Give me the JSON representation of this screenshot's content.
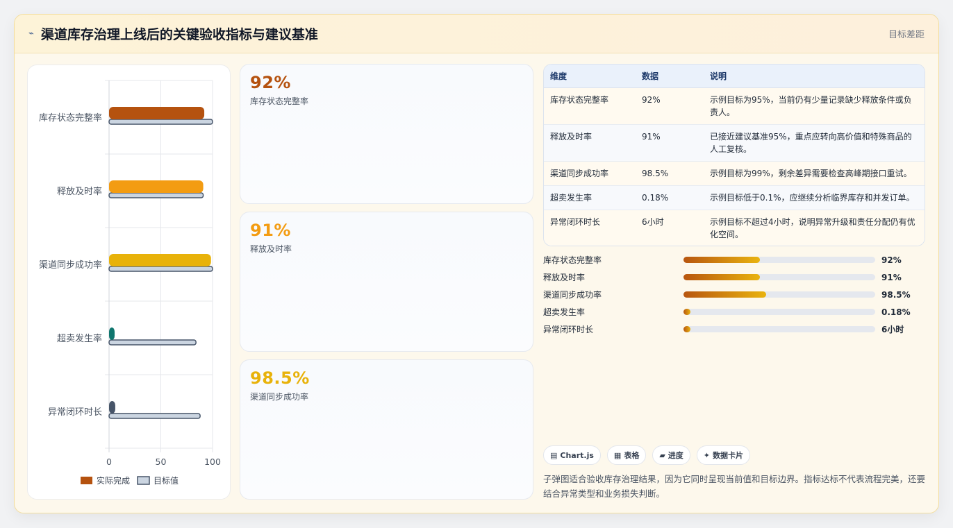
{
  "header": {
    "icon": "line-chart-icon",
    "title": "渠道库存治理上线后的关键验收指标与建议基准",
    "right_label": "目标差距"
  },
  "chart_data": {
    "type": "bar",
    "orientation": "horizontal",
    "categories": [
      "库存状态完整率",
      "释放及时率",
      "渠道同步成功率",
      "超卖发生率",
      "异常闭环时长"
    ],
    "series": [
      {
        "name": "实际完成",
        "values": [
          92,
          91,
          98.5,
          5,
          6
        ],
        "colors": [
          "#b5520f",
          "#f39c12",
          "#e8b20a",
          "#0f766e",
          "#475569"
        ]
      },
      {
        "name": "目标值",
        "values": [
          100,
          91,
          100,
          84,
          88
        ],
        "color": "#cbd5e1"
      }
    ],
    "xlim": [
      0,
      100
    ],
    "xticks": [
      "0",
      "50",
      "100"
    ],
    "legend_position": "bottom",
    "grid": true
  },
  "stats": [
    {
      "value": "92%",
      "label": "库存状态完整率",
      "color": "#b5520f"
    },
    {
      "value": "91%",
      "label": "释放及时率",
      "color": "#f39c12"
    },
    {
      "value": "98.5%",
      "label": "渠道同步成功率",
      "color": "#e8b20a"
    }
  ],
  "table": {
    "headers": [
      "维度",
      "数据",
      "说明"
    ],
    "rows": [
      [
        "库存状态完整率",
        "92%",
        "示例目标为95%，当前仍有少量记录缺少释放条件或负责人。"
      ],
      [
        "释放及时率",
        "91%",
        "已接近建议基准95%，重点应转向高价值和特殊商品的人工复核。"
      ],
      [
        "渠道同步成功率",
        "98.5%",
        "示例目标为99%，剩余差异需要检查高峰期接口重试。"
      ],
      [
        "超卖发生率",
        "0.18%",
        "示例目标低于0.1%，应继续分析临界库存和并发订单。"
      ],
      [
        "异常闭环时长",
        "6小时",
        "示例目标不超过4小时，说明异常升级和责任分配仍有优化空间。"
      ]
    ]
  },
  "progress": [
    {
      "label": "库存状态完整率",
      "value": "92%",
      "fill": 0.4
    },
    {
      "label": "释放及时率",
      "value": "91%",
      "fill": 0.398
    },
    {
      "label": "渠道同步成功率",
      "value": "98.5%",
      "fill": 0.43
    },
    {
      "label": "超卖发生率",
      "value": "0.18%",
      "fill": 0.035
    },
    {
      "label": "异常闭环时长",
      "value": "6小时",
      "fill": 0.035
    }
  ],
  "chips": [
    {
      "icon": "chart-icon",
      "glyph": "▤",
      "label": "Chart.js"
    },
    {
      "icon": "table-icon",
      "glyph": "▦",
      "label": "表格"
    },
    {
      "icon": "progress-icon",
      "glyph": "▰",
      "label": "进度"
    },
    {
      "icon": "sparkle-icon",
      "glyph": "✦",
      "label": "数据卡片"
    }
  ],
  "note": "子弹图适合验收库存治理结果，因为它同时呈现当前值和目标边界。指标达标不代表流程完美，还要结合异常类型和业务损失判断。"
}
